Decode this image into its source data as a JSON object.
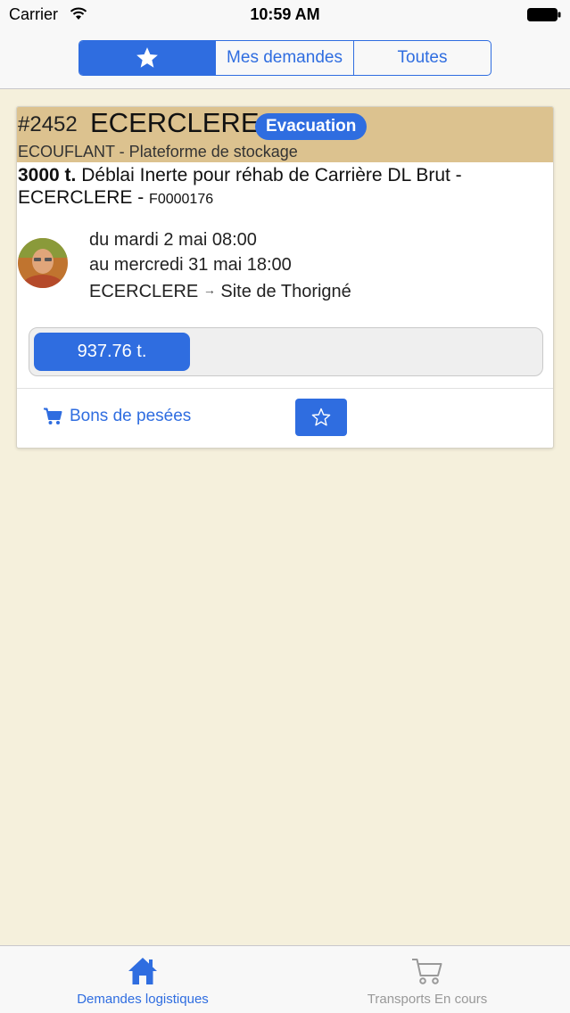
{
  "status_bar": {
    "carrier": "Carrier",
    "time": "10:59 AM"
  },
  "segmented": {
    "items": [
      {
        "icon": "star-icon",
        "label": ""
      },
      {
        "label": "Mes demandes"
      },
      {
        "label": "Toutes"
      }
    ],
    "selected_index": 0
  },
  "card": {
    "number": "#2452",
    "name": "ECERCLERE",
    "badge": "Evacuation",
    "subtitle": "ECOUFLANT - Plateforme de stockage",
    "quantity": "3000 t.",
    "description": "Déblai Inerte pour réhab de Carrière DL Brut - ECERCLERE -",
    "code": "F0000176",
    "date_from": "du mardi 2 mai 08:00",
    "date_to": "au mercredi 31 mai 18:00",
    "route_from": "ECERCLERE",
    "route_arrow": "→",
    "route_to": "Site de Thorigné",
    "progress_label": "937.76 t.",
    "progress_fraction": 0.31,
    "bons_label": "Bons de pesées",
    "favorite_icon": "star-outline-icon"
  },
  "tabbar": {
    "tabs": [
      {
        "label": "Demandes logistiques",
        "icon": "home-icon",
        "active": true
      },
      {
        "label": "Transports En cours",
        "icon": "cart-icon",
        "active": false
      }
    ]
  },
  "colors": {
    "accent": "#2f6de0",
    "header_bg": "#dcc28f",
    "page_bg": "#f5f0dc"
  }
}
